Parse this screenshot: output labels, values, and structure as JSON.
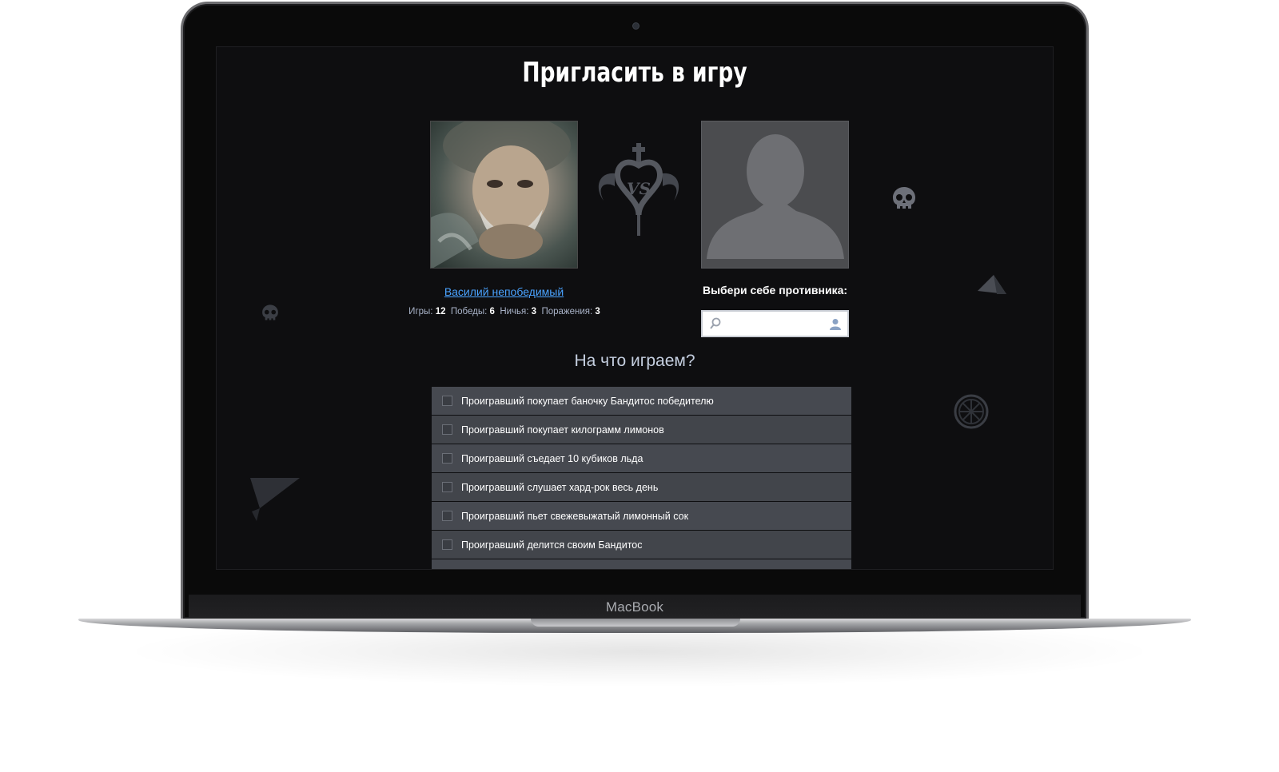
{
  "device": {
    "brand_label": "MacBook"
  },
  "page": {
    "title": "Пригласить в игру"
  },
  "player": {
    "name": "Василий непобедимый",
    "stats": [
      {
        "label": "Игры:",
        "value": "12"
      },
      {
        "label": "Победы:",
        "value": "6"
      },
      {
        "label": "Ничья:",
        "value": "3"
      },
      {
        "label": "Поражения:",
        "value": "3"
      }
    ]
  },
  "opponent": {
    "choose_label": "Выбери себе противника:",
    "search_value": ""
  },
  "bets": {
    "title": "На что играем?",
    "items": [
      {
        "label": "Проигравший покупает баночку Бандитос победителю",
        "checked": false
      },
      {
        "label": "Проигравший покупает килограмм лимонов",
        "checked": false
      },
      {
        "label": "Проигравший съедает 10 кубиков льда",
        "checked": false
      },
      {
        "label": "Проигравший слушает хард-рок весь день",
        "checked": false
      },
      {
        "label": "Проигравший пьет свежевыжатый лимонный сок",
        "checked": false
      },
      {
        "label": "Проигравший делится своим Бандитос",
        "checked": false
      }
    ]
  },
  "colors": {
    "screen_bg": "#0e0e10",
    "link": "#4aa3ff",
    "row_bg": "#42454b"
  },
  "icons": [
    "skull-icon",
    "paper-plane-icon",
    "lemon-slice-icon",
    "vs-emblem-icon",
    "search-icon",
    "user-icon",
    "avatar-silhouette-icon"
  ]
}
